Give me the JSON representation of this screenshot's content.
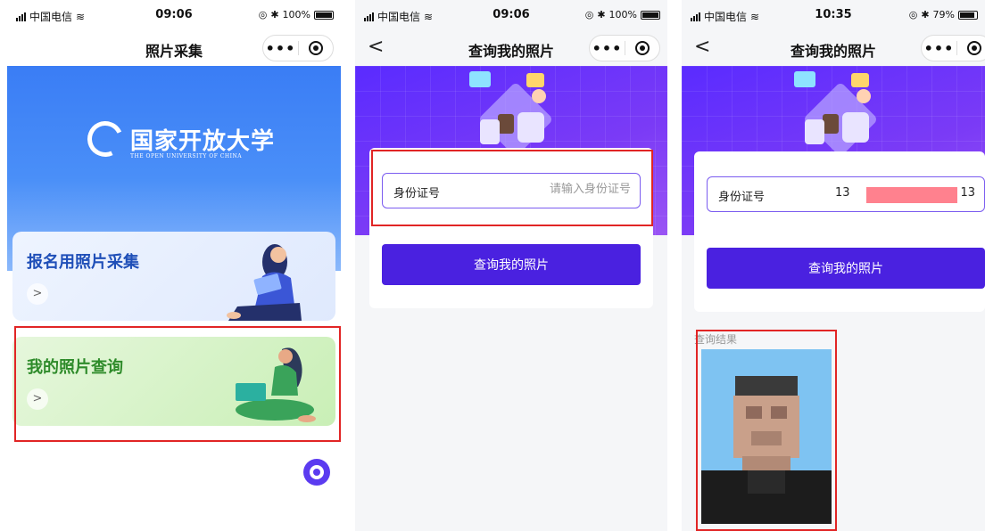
{
  "status": [
    {
      "carrier": "中国电信",
      "time": "09:06",
      "battery": "100%",
      "level": 1.0
    },
    {
      "carrier": "中国电信",
      "time": "09:06",
      "battery": "100%",
      "level": 1.0
    },
    {
      "carrier": "中国电信",
      "time": "10:35",
      "battery": "79%",
      "level": 0.79
    }
  ],
  "screen1": {
    "title": "照片采集",
    "logo_cn": "国家开放大学",
    "logo_en": "THE OPEN UNIVERSITY OF CHINA",
    "cards": [
      {
        "title": "报名用照片采集",
        "arrow": ">"
      },
      {
        "title": "我的照片查询",
        "arrow": ">"
      }
    ]
  },
  "screen2": {
    "title": "查询我的照片",
    "back": "<",
    "id_label": "身份证号",
    "id_placeholder": "请输入身份证号",
    "button": "查询我的照片"
  },
  "screen3": {
    "title": "查询我的照片",
    "back": "<",
    "id_label": "身份证号",
    "id_value": "13                              13",
    "button": "查询我的照片",
    "result_label": "查询结果"
  },
  "capsule": {
    "more": "•••"
  },
  "colors": {
    "primary": "#4a21e0",
    "highlight": "#e12525",
    "card1": "#1f4fb8",
    "card2": "#2e8b2a"
  }
}
